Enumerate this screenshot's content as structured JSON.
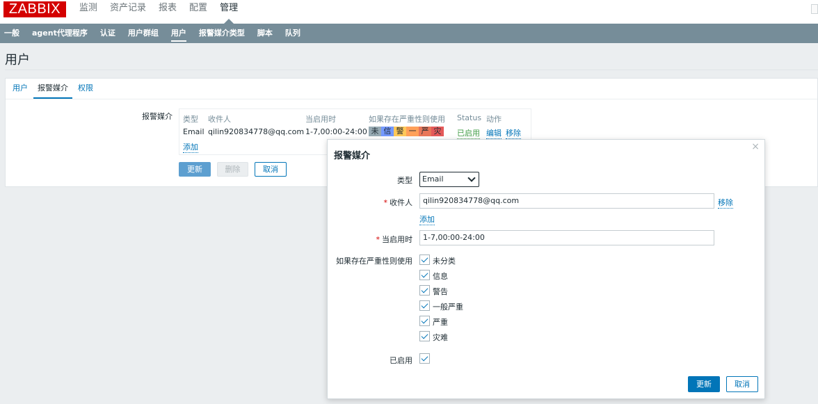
{
  "header": {
    "logo": "ZABBIX",
    "menu": [
      "监测",
      "资产记录",
      "报表",
      "配置",
      "管理"
    ],
    "active_menu": "管理"
  },
  "subnav": {
    "items": [
      "一般",
      "agent代理程序",
      "认证",
      "用户群组",
      "用户",
      "报警媒介类型",
      "脚本",
      "队列"
    ],
    "active": "用户"
  },
  "page_title": "用户",
  "tabs": {
    "items": [
      "用户",
      "报警媒介",
      "权限"
    ],
    "active": "报警媒介"
  },
  "media_form": {
    "label": "报警媒介",
    "columns": [
      "类型",
      "收件人",
      "当启用时",
      "如果存在严重性则使用",
      "Status",
      "动作"
    ],
    "row": {
      "type": "Email",
      "recipient": "qilin920834778@qq.com",
      "when_active": "1-7,00:00-24:00",
      "severities": [
        "未",
        "信",
        "警",
        "一",
        "严",
        "灾"
      ],
      "status": "已启用",
      "edit": "编辑",
      "remove": "移除"
    },
    "add": "添加",
    "buttons": {
      "update": "更新",
      "delete": "删除",
      "cancel": "取消"
    }
  },
  "colors": {
    "sev_not_classified": "#97aab3",
    "sev_information": "#7499ff",
    "sev_warning": "#ffc859",
    "sev_average": "#ffa059",
    "sev_high": "#e97659",
    "sev_disaster": "#e45959",
    "accent": "#0275b8"
  },
  "dialog": {
    "title": "报警媒介",
    "close": "×",
    "type_label": "类型",
    "type_value": "Email",
    "recipient_label": "收件人",
    "recipient_value": "qilin920834778@qq.com",
    "remove": "移除",
    "add": "添加",
    "when_active_label": "当启用时",
    "when_active_value": "1-7,00:00-24:00",
    "severity_label": "如果存在严重性则使用",
    "severities": [
      "未分类",
      "信息",
      "警告",
      "一般严重",
      "严重",
      "灾难"
    ],
    "enabled_label": "已启用",
    "buttons": {
      "update": "更新",
      "cancel": "取消"
    }
  }
}
